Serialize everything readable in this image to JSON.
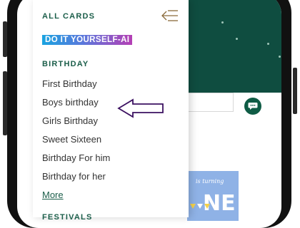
{
  "drawer": {
    "header": "ALL CARDS",
    "diy_label": "DO IT YOURSELF-AI",
    "section_title": "BIRTHDAY",
    "items": [
      {
        "label": "First Birthday"
      },
      {
        "label": "Boys birthday"
      },
      {
        "label": "Girls Birthday"
      },
      {
        "label": "Sweet Sixteen"
      },
      {
        "label": "Birthday For him"
      },
      {
        "label": "Birthday for her"
      }
    ],
    "more_label": "More",
    "next_section": "FESTIVALS"
  },
  "background": {
    "card_text_top": "is turning",
    "card_text_big": "NE"
  },
  "colors": {
    "brand_green": "#1b5e4a",
    "banner_green": "#0f4d40",
    "annotation_purple": "#3b1060"
  },
  "icons": {
    "back": "menu-collapse-arrow-icon",
    "chat": "chat-bubble-icon",
    "annotation": "pointer-arrow-icon"
  }
}
